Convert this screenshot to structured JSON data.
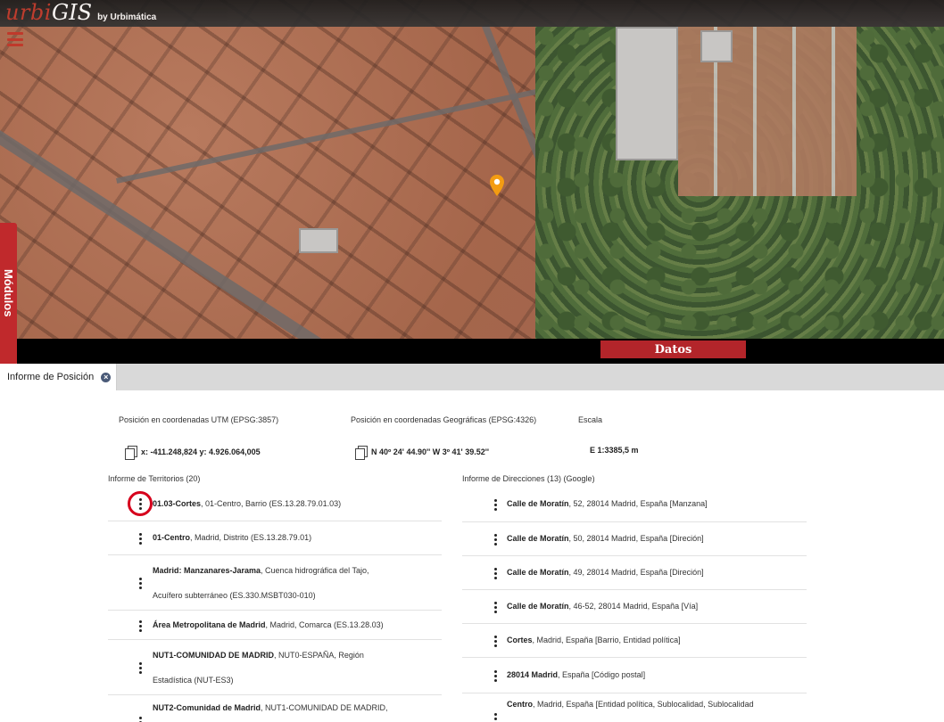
{
  "app": {
    "logo_urbi": "urbi",
    "logo_gis": "GIS",
    "logo_by": "by Urbimática"
  },
  "side": {
    "modulos_label": "Módulos"
  },
  "panel": {
    "datos_label": "Datos"
  },
  "tabs": [
    {
      "label": "Informe de Posición"
    }
  ],
  "coords": {
    "utm_label": "Posición en coordenadas UTM (EPSG:3857)",
    "geo_label": "Posición en coordenadas Geográficas (EPSG:4326)",
    "scale_label": "Escala",
    "utm_value": "x: -411.248,824 y: 4.926.064,005",
    "geo_value": "N 40º 24' 44.90'' W 3º 41' 39.52''",
    "scale_value": "E 1:3385,5 m"
  },
  "territorios": {
    "title": "Informe de Territorios (20)",
    "rows": [
      {
        "bold": "01.03-Cortes",
        "rest": ", 01-Centro, Barrio (ES.13.28.79.01.03)"
      },
      {
        "bold": "01-Centro",
        "rest": ", Madrid, Distrito (ES.13.28.79.01)"
      },
      {
        "bold": "Madrid: Manzanares-Jarama",
        "rest": ", Cuenca hidrográfica del Tajo,",
        "line2": "Acuífero subterráneo (ES.330.MSBT030-010)"
      },
      {
        "bold": "Área Metropolitana de Madrid",
        "rest": ", Madrid, Comarca (ES.13.28.03)"
      },
      {
        "bold": "NUT1-COMUNIDAD DE MADRID",
        "rest": ", NUT0-ESPAÑA, Región",
        "line2": "Estadística (NUT-ES3)"
      },
      {
        "bold": "NUT2-Comunidad de Madrid",
        "rest": ", NUT1-COMUNIDAD DE MADRID,"
      }
    ]
  },
  "direcciones": {
    "title": "Informe de Direcciones (13) (Google)",
    "rows": [
      {
        "bold": "Calle de Moratín",
        "rest": ", 52, 28014 Madrid, España [Manzana]"
      },
      {
        "bold": "Calle de Moratín",
        "rest": ", 50, 28014 Madrid, España [Direción]"
      },
      {
        "bold": "Calle de Moratín",
        "rest": ", 49, 28014 Madrid, España [Direción]"
      },
      {
        "bold": "Calle de Moratín",
        "rest": ", 46-52, 28014 Madrid, España [Vía]"
      },
      {
        "bold": "Cortes",
        "rest": ", Madrid, España [Barrio, Entidad política]"
      },
      {
        "bold": "28014 Madrid",
        "rest": ", España [Código postal]"
      },
      {
        "bold": "Centro",
        "rest": ", Madrid, España [Entidad política, Sublocalidad, Sublocalidad"
      }
    ]
  },
  "colors": {
    "accent": "#c0292c",
    "highlight_circle": "#d6001c",
    "pin": "#f39c12"
  }
}
